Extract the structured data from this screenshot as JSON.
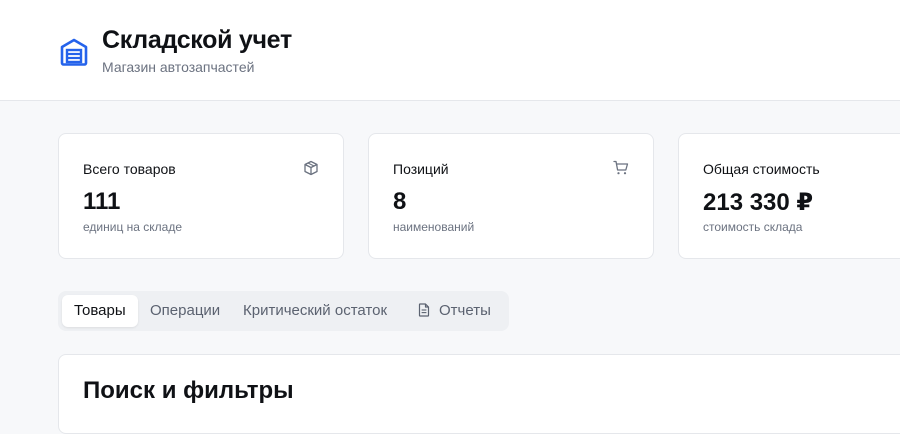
{
  "header": {
    "logo_icon": "warehouse-icon",
    "title": "Складской учет",
    "subtitle": "Магазин автозапчастей",
    "accent_color": "#2563eb"
  },
  "stats": [
    {
      "label": "Всего товаров",
      "value": "111",
      "caption": "единиц на складе",
      "icon": "package-icon"
    },
    {
      "label": "Позиций",
      "value": "8",
      "caption": "наименований",
      "icon": "cart-icon"
    },
    {
      "label": "Общая стоимость",
      "value": "213 330 ₽",
      "caption": "стоимость склада",
      "icon": ""
    }
  ],
  "tabs": [
    {
      "label": "Товары",
      "active": true
    },
    {
      "label": "Операции",
      "active": false
    },
    {
      "label": "Критический остаток",
      "active": false
    },
    {
      "label": "Отчеты",
      "active": false,
      "icon": "document-icon"
    }
  ],
  "filters": {
    "title": "Поиск и фильтры"
  }
}
